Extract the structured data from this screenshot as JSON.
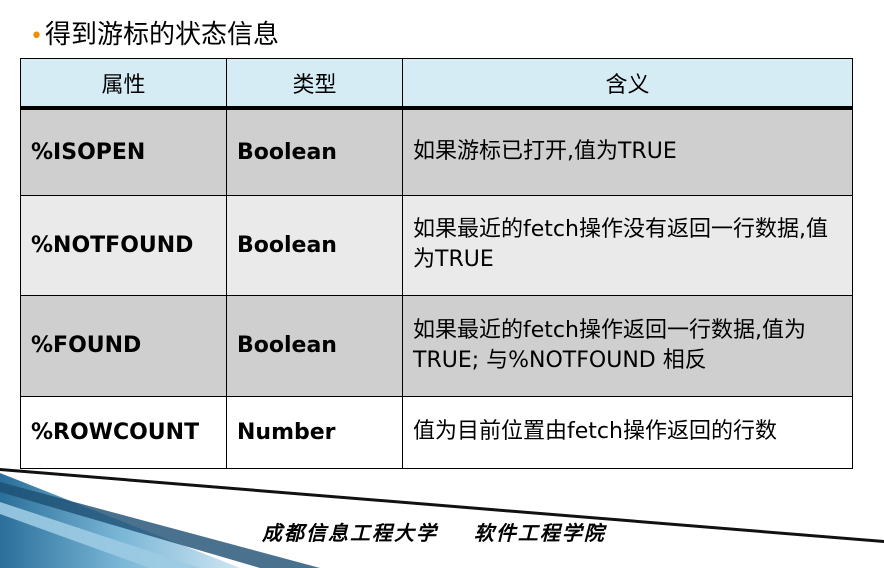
{
  "title": {
    "bullet": "•",
    "text": "得到游标的状态信息"
  },
  "table": {
    "headers": [
      "属性",
      "类型",
      "含义"
    ],
    "rows": [
      {
        "attr": "%ISOPEN",
        "type": "Boolean",
        "desc": "如果游标已打开,值为TRUE"
      },
      {
        "attr": "%NOTFOUND",
        "type": "Boolean",
        "desc": "如果最近的fetch操作没有返回一行数据,值为TRUE"
      },
      {
        "attr": "%FOUND",
        "type": "Boolean",
        "desc": "如果最近的fetch操作返回一行数据,值为TRUE; 与%NOTFOUND 相反"
      },
      {
        "attr": "%ROWCOUNT",
        "type": "Number",
        "desc": "值为目前位置由fetch操作返回的行数"
      }
    ]
  },
  "footer": "成都信息工程大学    软件工程学院"
}
